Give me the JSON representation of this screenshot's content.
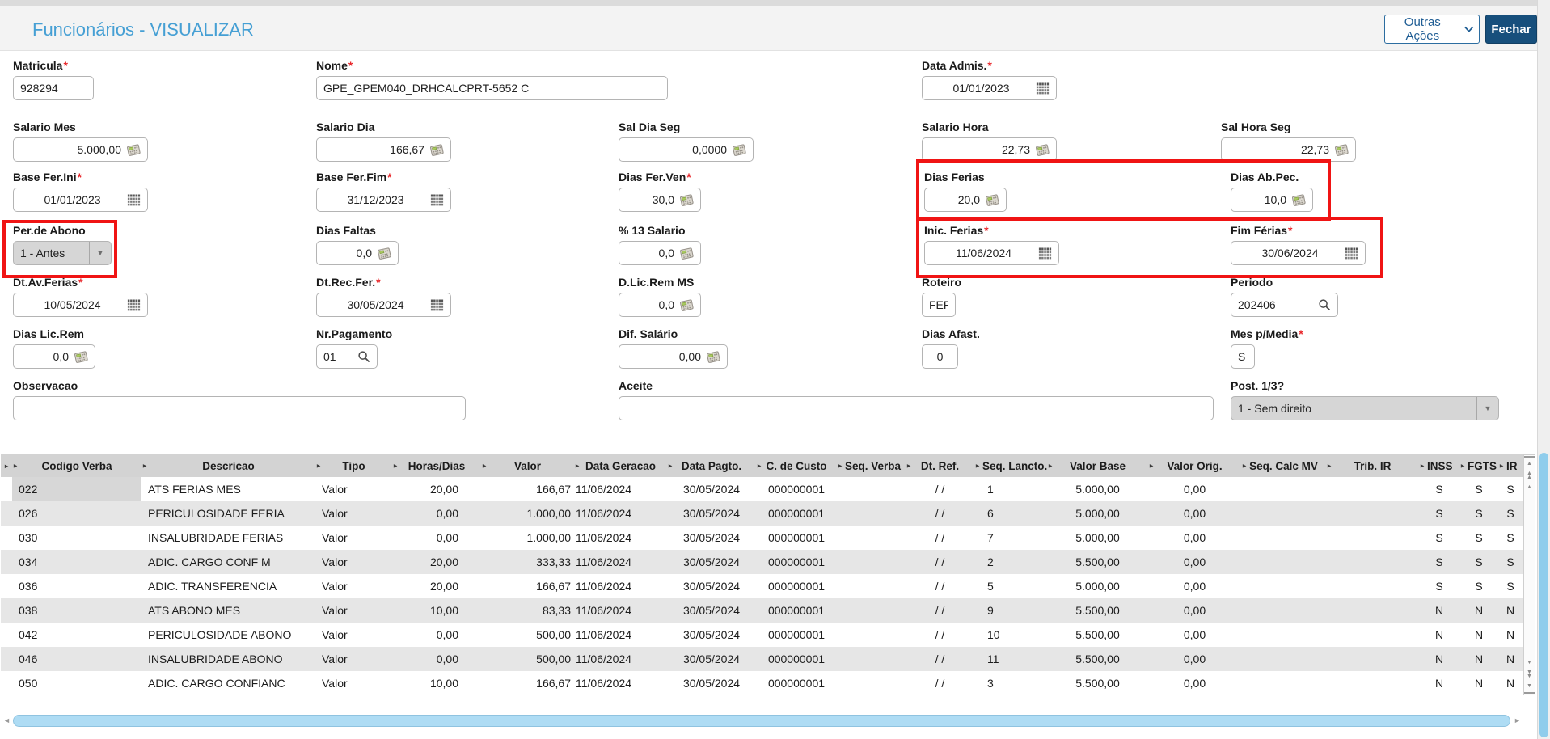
{
  "titlebar": {
    "title": "Funcionários - VISUALIZAR",
    "other_actions": "Outras Ações",
    "close": "Fechar"
  },
  "colors": {
    "title_blue": "#459fd4",
    "primary_button": "#174f7c",
    "highlight_red": "#f01414",
    "scrollbar_blue": "#aedcf4",
    "grid_header_grey": "#d3d3d3",
    "grid_alt_row": "#e6e6e6"
  },
  "icons": {
    "sort_arrow": "▸",
    "dropdown": "▼",
    "scroll_up": "▲",
    "scroll_up_double": "▲▲",
    "scroll_down": "▼",
    "scroll_down_double": "▼▼",
    "scroll_left": "◄",
    "scroll_right": "►",
    "calendar": "calendar-icon",
    "calculator": "calculator-icon",
    "search": "search-icon",
    "chevron_down": "chevron-down-icon"
  },
  "fields": {
    "matricula": {
      "label": "Matricula",
      "req": "*",
      "value": "928294"
    },
    "nome": {
      "label": "Nome",
      "req": "*",
      "value": "GPE_GPEM040_DRHCALCPRT-5652 C"
    },
    "data_admis": {
      "label": "Data Admis.",
      "req": "*",
      "value": "01/01/2023"
    },
    "salario_mes": {
      "label": "Salario Mes",
      "value": "5.000,00"
    },
    "salario_dia": {
      "label": "Salario Dia",
      "value": "166,67"
    },
    "sal_dia_seg": {
      "label": "Sal Dia Seg",
      "value": "0,0000"
    },
    "salario_hora": {
      "label": "Salario Hora",
      "value": "22,73"
    },
    "sal_hora_seg": {
      "label": "Sal Hora Seg",
      "value": "22,73"
    },
    "base_fer_ini": {
      "label": "Base Fer.Ini",
      "req": "*",
      "value": "01/01/2023"
    },
    "base_fer_fim": {
      "label": "Base Fer.Fim",
      "req": "*",
      "value": "31/12/2023"
    },
    "dias_fer_ven": {
      "label": "Dias Fer.Ven",
      "req": "*",
      "value": "30,0"
    },
    "dias_ferias": {
      "label": "Dias Ferias",
      "value": "20,0"
    },
    "dias_ab_pec": {
      "label": "Dias Ab.Pec.",
      "value": "10,0"
    },
    "per_de_abono": {
      "label": "Per.de Abono",
      "value": "1 - Antes"
    },
    "dias_faltas": {
      "label": "Dias Faltas",
      "value": "0,0"
    },
    "pct_13_salario": {
      "label": "% 13 Salario",
      "value": "0,0"
    },
    "inic_ferias": {
      "label": "Inic. Ferias",
      "req": "*",
      "value": "11/06/2024"
    },
    "fim_ferias": {
      "label": "Fim Férias",
      "req": "*",
      "value": "30/06/2024"
    },
    "dt_av_ferias": {
      "label": "Dt.Av.Ferias",
      "req": "*",
      "value": "10/05/2024"
    },
    "dt_rec_fer": {
      "label": "Dt.Rec.Fer.",
      "req": "*",
      "value": "30/05/2024"
    },
    "d_lic_rem_ms": {
      "label": "D.Lic.Rem MS",
      "value": "0,0"
    },
    "roteiro": {
      "label": "Roteiro",
      "value": "FER"
    },
    "periodo": {
      "label": "Periodo",
      "value": "202406"
    },
    "dias_lic_rem": {
      "label": "Dias Lic.Rem",
      "value": "0,0"
    },
    "nr_pagamento": {
      "label": "Nr.Pagamento",
      "value": "01"
    },
    "dif_salario": {
      "label": "Dif. Salário",
      "value": "0,00"
    },
    "dias_afast": {
      "label": "Dias Afast.",
      "value": "0"
    },
    "mes_p_media": {
      "label": "Mes p/Media",
      "req": "*",
      "value": "S"
    },
    "observacao": {
      "label": "Observacao",
      "value": ""
    },
    "aceite": {
      "label": "Aceite",
      "value": ""
    },
    "post_13": {
      "label": "Post. 1/3?",
      "value": "1 - Sem direito"
    }
  },
  "table": {
    "columns": [
      "Codigo Verba",
      "Descricao",
      "Tipo",
      "Horas/Dias",
      "Valor",
      "Data Geracao",
      "Data Pagto.",
      "C. de Custo",
      "Seq. Verba",
      "Dt. Ref.",
      "Seq. Lancto.",
      "Valor Base",
      "Valor Orig.",
      "Seq. Calc MV",
      "Trib. IR",
      "INSS",
      "FGTS",
      "IR"
    ],
    "rows": [
      [
        "022",
        "ATS FERIAS MES",
        "Valor",
        "20,00",
        "166,67",
        "11/06/2024",
        "30/05/2024",
        "000000001",
        "",
        "/ /",
        "1",
        "5.000,00",
        "0,00",
        "",
        "",
        "S",
        "S",
        "S"
      ],
      [
        "026",
        "PERICULOSIDADE FERIA",
        "Valor",
        "0,00",
        "1.000,00",
        "11/06/2024",
        "30/05/2024",
        "000000001",
        "",
        "/ /",
        "6",
        "5.000,00",
        "0,00",
        "",
        "",
        "S",
        "S",
        "S"
      ],
      [
        "030",
        "INSALUBRIDADE FERIAS",
        "Valor",
        "0,00",
        "1.000,00",
        "11/06/2024",
        "30/05/2024",
        "000000001",
        "",
        "/ /",
        "7",
        "5.000,00",
        "0,00",
        "",
        "",
        "S",
        "S",
        "S"
      ],
      [
        "034",
        "ADIC. CARGO CONF M",
        "Valor",
        "20,00",
        "333,33",
        "11/06/2024",
        "30/05/2024",
        "000000001",
        "",
        "/ /",
        "2",
        "5.500,00",
        "0,00",
        "",
        "",
        "S",
        "S",
        "S"
      ],
      [
        "036",
        "ADIC. TRANSFERENCIA",
        "Valor",
        "20,00",
        "166,67",
        "11/06/2024",
        "30/05/2024",
        "000000001",
        "",
        "/ /",
        "5",
        "5.000,00",
        "0,00",
        "",
        "",
        "S",
        "S",
        "S"
      ],
      [
        "038",
        "ATS ABONO MES",
        "Valor",
        "10,00",
        "83,33",
        "11/06/2024",
        "30/05/2024",
        "000000001",
        "",
        "/ /",
        "9",
        "5.500,00",
        "0,00",
        "",
        "",
        "N",
        "N",
        "N"
      ],
      [
        "042",
        "PERICULOSIDADE ABONO",
        "Valor",
        "0,00",
        "500,00",
        "11/06/2024",
        "30/05/2024",
        "000000001",
        "",
        "/ /",
        "10",
        "5.500,00",
        "0,00",
        "",
        "",
        "N",
        "N",
        "N"
      ],
      [
        "046",
        "INSALUBRIDADE ABONO",
        "Valor",
        "0,00",
        "500,00",
        "11/06/2024",
        "30/05/2024",
        "000000001",
        "",
        "/ /",
        "11",
        "5.500,00",
        "0,00",
        "",
        "",
        "N",
        "N",
        "N"
      ],
      [
        "050",
        "ADIC. CARGO CONFIANC",
        "Valor",
        "10,00",
        "166,67",
        "11/06/2024",
        "30/05/2024",
        "000000001",
        "",
        "/ /",
        "3",
        "5.500,00",
        "0,00",
        "",
        "",
        "N",
        "N",
        "N"
      ]
    ]
  }
}
